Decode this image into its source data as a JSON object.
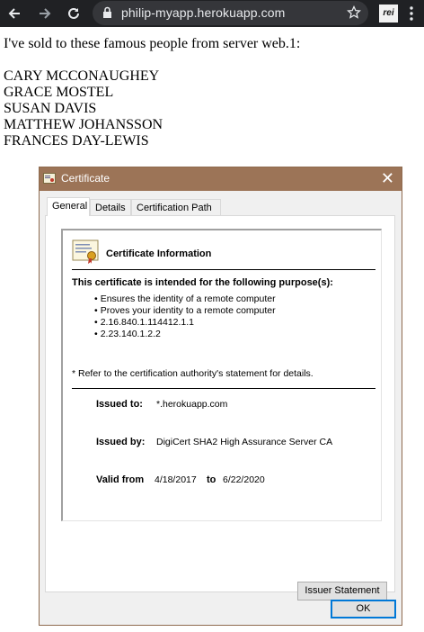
{
  "browser": {
    "url": "philip-myapp.herokuapp.com",
    "extension_label": "rei"
  },
  "page": {
    "intro": "I've sold to these famous people from server web.1:",
    "names": [
      "CARY MCCONAUGHEY",
      "GRACE MOSTEL",
      "SUSAN DAVIS",
      "MATTHEW JOHANSSON",
      "FRANCES DAY-LEWIS"
    ]
  },
  "dialog": {
    "title": "Certificate",
    "close_glyph": "✕",
    "tabs": [
      "General",
      "Details",
      "Certification Path"
    ],
    "active_tab": "General",
    "info_title": "Certificate Information",
    "purpose_title": "This certificate is intended for the following purpose(s):",
    "purposes": [
      "Ensures the identity of a remote computer",
      "Proves your identity to a remote computer",
      "2.16.840.1.114412.1.1",
      "2.23.140.1.2.2"
    ],
    "footnote": "* Refer to the certification authority's statement for details.",
    "issued_to_label": "Issued to:",
    "issued_to_value": "*.herokuapp.com",
    "issued_by_label": "Issued by:",
    "issued_by_value": "DigiCert SHA2 High Assurance Server CA",
    "valid_from_label": "Valid from",
    "valid_from_value": "4/18/2017",
    "valid_to_label": "to",
    "valid_to_value": "6/22/2020",
    "issuer_statement_button": "Issuer Statement",
    "ok_button": "OK"
  },
  "colors": {
    "titlebar": "#9c7457",
    "toolbar": "#202124",
    "ok_border": "#0078d7"
  }
}
